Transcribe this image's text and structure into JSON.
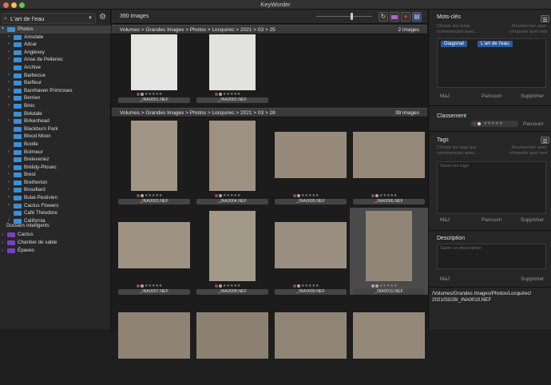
{
  "app": {
    "title": "KeyWorder"
  },
  "sidebar": {
    "folder_selector": "L'art de l'eau",
    "root": "Photos",
    "folders": [
      "Ainsdale",
      "Aitcar",
      "Anglesey",
      "Anse de Pellenec",
      "Archive",
      "Barbecue",
      "Barfleur",
      "Barnhaven Primroses",
      "Berrien",
      "Binic",
      "Birkdale",
      "Birkenhead",
      "Blackburn Park",
      "Blood Moon",
      "Bootle",
      "Botmeur",
      "Brelevenez",
      "Brélidy-Plouec",
      "Brest",
      "Bretherton",
      "Brouillard",
      "Bulat-Pestivien",
      "Cactus Flowers",
      "Café Théodore",
      "California"
    ],
    "expandable": [
      true,
      true,
      true,
      true,
      false,
      true,
      true,
      true,
      true,
      true,
      false,
      true,
      false,
      false,
      false,
      true,
      false,
      true,
      true,
      true,
      true,
      true,
      true,
      false,
      true
    ],
    "smart_title": "Dossiers Intelligents",
    "smart_folders": [
      "Cactus",
      "Chantier de sable",
      "Épaves"
    ]
  },
  "main": {
    "image_count": "390 images",
    "zoom_level": 0.62,
    "sections": [
      {
        "path": "Volumes > Grandes Images > Photos > Locquirec > 2021 > 03 > 25",
        "count": "2 images",
        "items": [
          {
            "name": "_INA0001.NEF",
            "tone": "#e4e4e2",
            "dot": "#9a4545"
          },
          {
            "name": "_INA0002.NEF",
            "tone": "#e2e2e0",
            "dot": "#9a4545"
          }
        ]
      },
      {
        "path": "Volumes > Grandes Images > Photos > Locquirec > 2021 > 03 > 28",
        "count": "39 images",
        "items": [
          {
            "name": "_INA0003.NEF",
            "tone": "#a09585",
            "dot": "#9a4545"
          },
          {
            "name": "_INA0004.NEF",
            "tone": "#9d9181",
            "dot": "#9a4545"
          },
          {
            "name": "_INA0005.NEF",
            "tone": "#978a7a",
            "dot": "#9a4545"
          },
          {
            "name": "_INA0006.NEF",
            "tone": "#958979",
            "dot": "#9a4545"
          },
          {
            "name": "_INA0007.NEF",
            "tone": "#9e9383",
            "dot": "#9a4545"
          },
          {
            "name": "_INA0008.NEF",
            "tone": "#a39987",
            "dot": "#9a4545"
          },
          {
            "name": "_INA0009.NEF",
            "tone": "#9a8f80",
            "dot": "#9a4545"
          },
          {
            "name": "_INA0010.NEF",
            "tone": "#918676",
            "dot": "#c98faf"
          },
          {
            "name": "",
            "tone": "#8f8474",
            "dot": ""
          },
          {
            "name": "",
            "tone": "#8c8171",
            "dot": ""
          },
          {
            "name": "",
            "tone": "#908575",
            "dot": ""
          },
          {
            "name": "",
            "tone": "#948979",
            "dot": ""
          }
        ]
      }
    ]
  },
  "right": {
    "keywords": {
      "title": "Mots-clés",
      "hint_left": "Choisir les mots commençant avec...",
      "hint_right": "Rechercher avec n'importe quel mot",
      "tags": [
        "Diagonal",
        "L'art de l'eau"
      ],
      "mj": "MàJ",
      "browse": "Parcourir",
      "delete": "Supprimer"
    },
    "rating": {
      "title": "Classement",
      "browse": "Parcourir"
    },
    "tags": {
      "title": "Tags",
      "hint_left": "Choisir les tags qui commençant avec...",
      "hint_right": "Rechercher avec n'importe quel mot",
      "placeholder": "Saisir les tags",
      "mj": "MàJ",
      "browse": "Parcourir",
      "delete": "Supprimer"
    },
    "description": {
      "title": "Description",
      "placeholder": "Saisir un description",
      "mj": "MàJ",
      "delete": "Supprimer"
    },
    "file_path": "/Volumes/Grandes Images/Photos/Locquirec/ 2021/03/28/_INA0010.NEF"
  },
  "colors": {
    "accent": "#3b8fd6",
    "smart_folder": "#7a3fc8",
    "tag": "#2b5aa0",
    "close": "#ed6a5e",
    "minimize": "#f5bf4f",
    "zoom": "#62c554"
  }
}
